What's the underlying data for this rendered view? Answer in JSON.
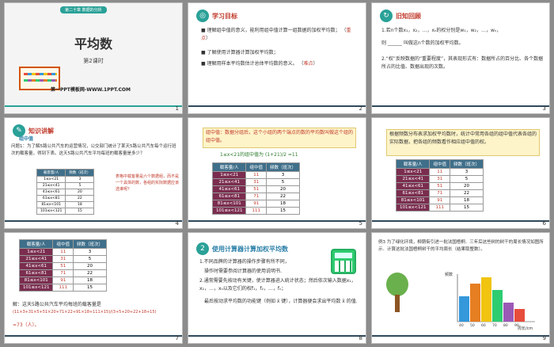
{
  "slides": [
    {
      "num": "1",
      "title": "平均数",
      "subtitle": "第2课时",
      "site": "第一PPT模板网-WWW.1PPT.COM",
      "banner": "第二十章 数据的分析"
    },
    {
      "num": "2",
      "heading": "学习目标",
      "goals": [
        "理解组中值的意义，能利用组中值计算一组数据的加权平均数；",
        "了解使用计算器计算加权平均数；",
        "理解用样本平均数估计总体平均数的意义。"
      ],
      "keynote": "重点",
      "diffnote": "难点"
    },
    {
      "num": "3",
      "heading": "旧知回顾",
      "lines": [
        "1.若n个数x₁，x₂，…，xₙ的权分别是w₁，w₂，…，wₙ，",
        "则 ______ 叫做这n个数的加权平均数。",
        "2.“权”反映数据的“重要程度”，其表现形式有：数据所占的百分比、各个数据所占的比值、数据出现的次数。"
      ]
    },
    {
      "num": "4",
      "heading": "知识讲解",
      "sub": "组中值",
      "problem": "问题1：为了解5路公共汽车的运营情况，公交部门统计了某天5路公共汽车每个运行班次的载客量，得到下表。这天5路公共汽车平均每班的载客量是多少？",
      "note": "表格中载客量是六个数据组，而不是一个具体的数，各组的实际数据应该选谁呢？"
    },
    {
      "num": "5",
      "box": "组中值：数据分组后，这个小组的两个端点的数的平均数叫做这个组的组中值。",
      "example": "1≤x<21的组中值为 (1+21)/2 =11"
    },
    {
      "num": "6",
      "box": "根据频数分布表求加权平均数时，统计中常用各组的组中值代表各组的实际数据，把各组的频数看作相应组中值的权。"
    },
    {
      "num": "7",
      "answer": "解：这天5路公共汽车平均每班的载客量是",
      "formula": "(11×3+31×5+51×20+71×22+91×18+111×15)/(3+5+20+22+18+15)",
      "result": "≈73（人）。"
    },
    {
      "num": "8",
      "heading": "使用计算器计算加权平均数",
      "steps": [
        "1.不同品牌的计算器的操作步骤有所不同，",
        "操作时需要参阅计算器的使用说明书.",
        "2.通常需要先按动有关键，使计算器进入统计状态；然后依次输入数据x₁，x₂，…，xₙ以及它们的权f₁，f₂，…，fₙ；",
        "最后按动求平均数的功能键（例如 x̄ 键），计算器便会求出平均数 x̄ 的值."
      ]
    },
    {
      "num": "9",
      "example": "例3 为了绿化环境，柳荫街引进一批法国梧桐．三年后这些树的树干的周长情况如图所示．计算这批法国梧桐树干的平均周长（结果取整数）。",
      "xlabel": "周长/cm",
      "ylabel": "频数"
    }
  ],
  "table": {
    "headers": [
      "载客量/人",
      "组中值",
      "频数（班次）"
    ],
    "rows": [
      [
        "1≤x<21",
        "11",
        "3"
      ],
      [
        "21≤x<41",
        "31",
        "5"
      ],
      [
        "41≤x<61",
        "51",
        "20"
      ],
      [
        "61≤x<81",
        "71",
        "22"
      ],
      [
        "81≤x<101",
        "91",
        "18"
      ],
      [
        "101≤x<121",
        "111",
        "15"
      ]
    ]
  },
  "chart_data": {
    "type": "bar",
    "categories": [
      "40",
      "50",
      "60",
      "70",
      "80",
      "90"
    ],
    "values": [
      8,
      12,
      14,
      10,
      6,
      4
    ],
    "xlabel": "周长/cm",
    "ylabel": "频数",
    "ylim": [
      0,
      14
    ]
  }
}
